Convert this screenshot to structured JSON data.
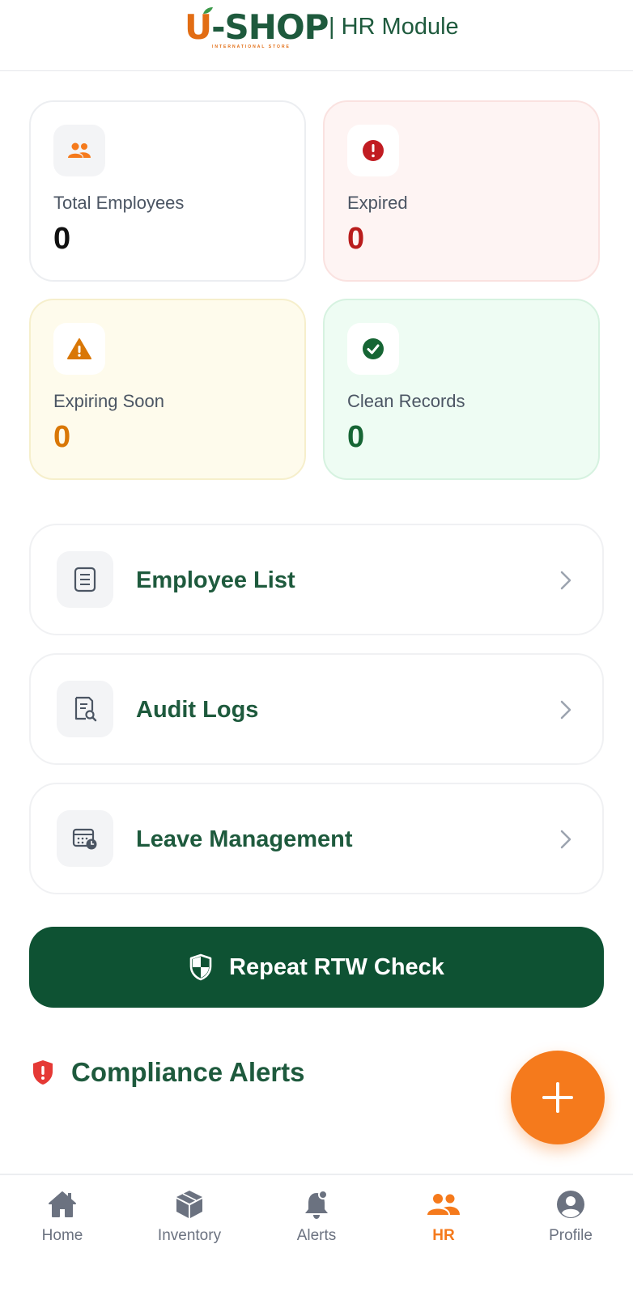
{
  "header": {
    "logo_text_u": "U",
    "logo_text_rest": "-SHOP",
    "logo_subtitle": "INTERNATIONAL STORE",
    "module_title": "| HR Module"
  },
  "stats": {
    "total": {
      "label": "Total Employees",
      "value": "0",
      "icon": "users-icon",
      "color": "#111111"
    },
    "expired": {
      "label": "Expired",
      "value": "0",
      "icon": "alert-circle-icon",
      "color": "#b91c1c"
    },
    "expiring": {
      "label": "Expiring Soon",
      "value": "0",
      "icon": "warning-triangle-icon",
      "color": "#d97706"
    },
    "clean": {
      "label": "Clean Records",
      "value": "0",
      "icon": "check-circle-icon",
      "color": "#166534"
    }
  },
  "menu": {
    "employee_list": {
      "label": "Employee List",
      "icon": "list-document-icon"
    },
    "audit_logs": {
      "label": "Audit Logs",
      "icon": "document-search-icon"
    },
    "leave_management": {
      "label": "Leave Management",
      "icon": "calendar-clock-icon"
    }
  },
  "rtw_button": {
    "label": "Repeat RTW Check",
    "icon": "shield-icon"
  },
  "compliance": {
    "title": "Compliance Alerts",
    "icon": "shield-alert-icon"
  },
  "fab": {
    "icon": "plus-icon"
  },
  "nav": {
    "items": [
      {
        "label": "Home",
        "icon": "home-icon",
        "active": false
      },
      {
        "label": "Inventory",
        "icon": "box-icon",
        "active": false
      },
      {
        "label": "Alerts",
        "icon": "bell-icon",
        "active": false
      },
      {
        "label": "HR",
        "icon": "users-icon",
        "active": true
      },
      {
        "label": "Profile",
        "icon": "user-circle-icon",
        "active": false
      }
    ]
  },
  "colors": {
    "brand_green": "#1e5a3d",
    "brand_orange": "#f57a1c",
    "button_green": "#0e5233"
  }
}
